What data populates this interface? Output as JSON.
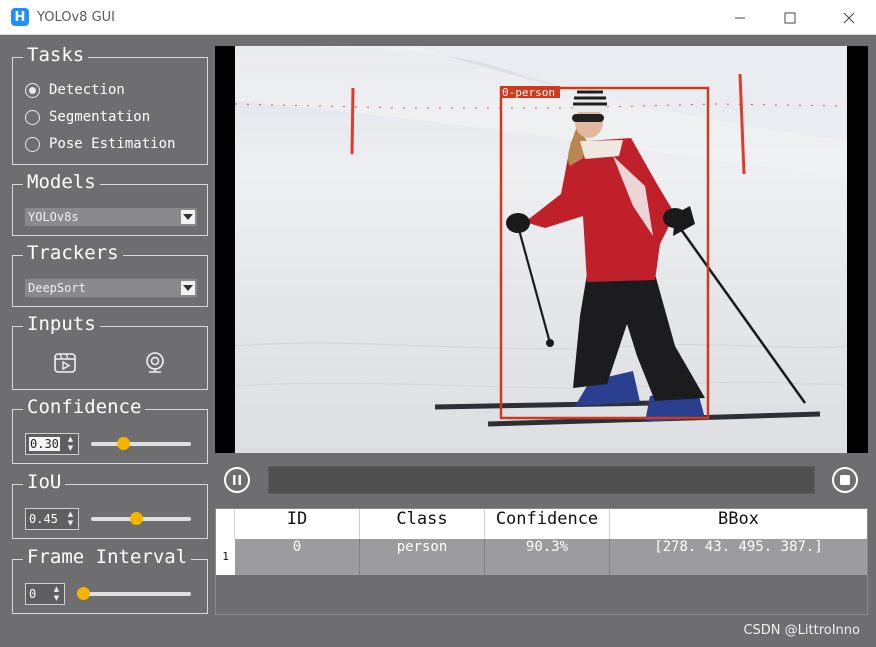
{
  "window": {
    "title": "YOLOv8 GUI",
    "icon_letter": "H"
  },
  "tasks": {
    "title": "Tasks",
    "options": [
      {
        "label": "Detection",
        "selected": true
      },
      {
        "label": "Segmentation",
        "selected": false
      },
      {
        "label": "Pose Estimation",
        "selected": false
      }
    ]
  },
  "models": {
    "title": "Models",
    "selected": "YOLOv8s"
  },
  "trackers": {
    "title": "Trackers",
    "selected": "DeepSort"
  },
  "inputs": {
    "title": "Inputs",
    "icons": [
      "video-file-icon",
      "webcam-icon"
    ]
  },
  "confidence": {
    "title": "Confidence",
    "value": "0.30",
    "slider_level": 0.3
  },
  "iou": {
    "title": "IoU",
    "value": "0.45",
    "slider_level": 0.45
  },
  "frame_interval": {
    "title": "Frame Interval",
    "value": "0",
    "slider_level": 0.0
  },
  "detection_overlay": {
    "label": "0-person",
    "box_color": "#d03a1c"
  },
  "player": {
    "pause_icon": "pause-icon",
    "stop_icon": "stop-icon"
  },
  "results_table": {
    "headers": [
      "ID",
      "Class",
      "Confidence",
      "BBox"
    ],
    "rows": [
      {
        "row_number": "1",
        "id": "0",
        "class": "person",
        "confidence": "90.3%",
        "bbox": "[278.  43. 495. 387.]"
      }
    ]
  },
  "watermark": "CSDN @LittroInno",
  "colors": {
    "accent": "#f4b400",
    "panel_bg": "#6e6e70",
    "box": "#d03a1c"
  }
}
